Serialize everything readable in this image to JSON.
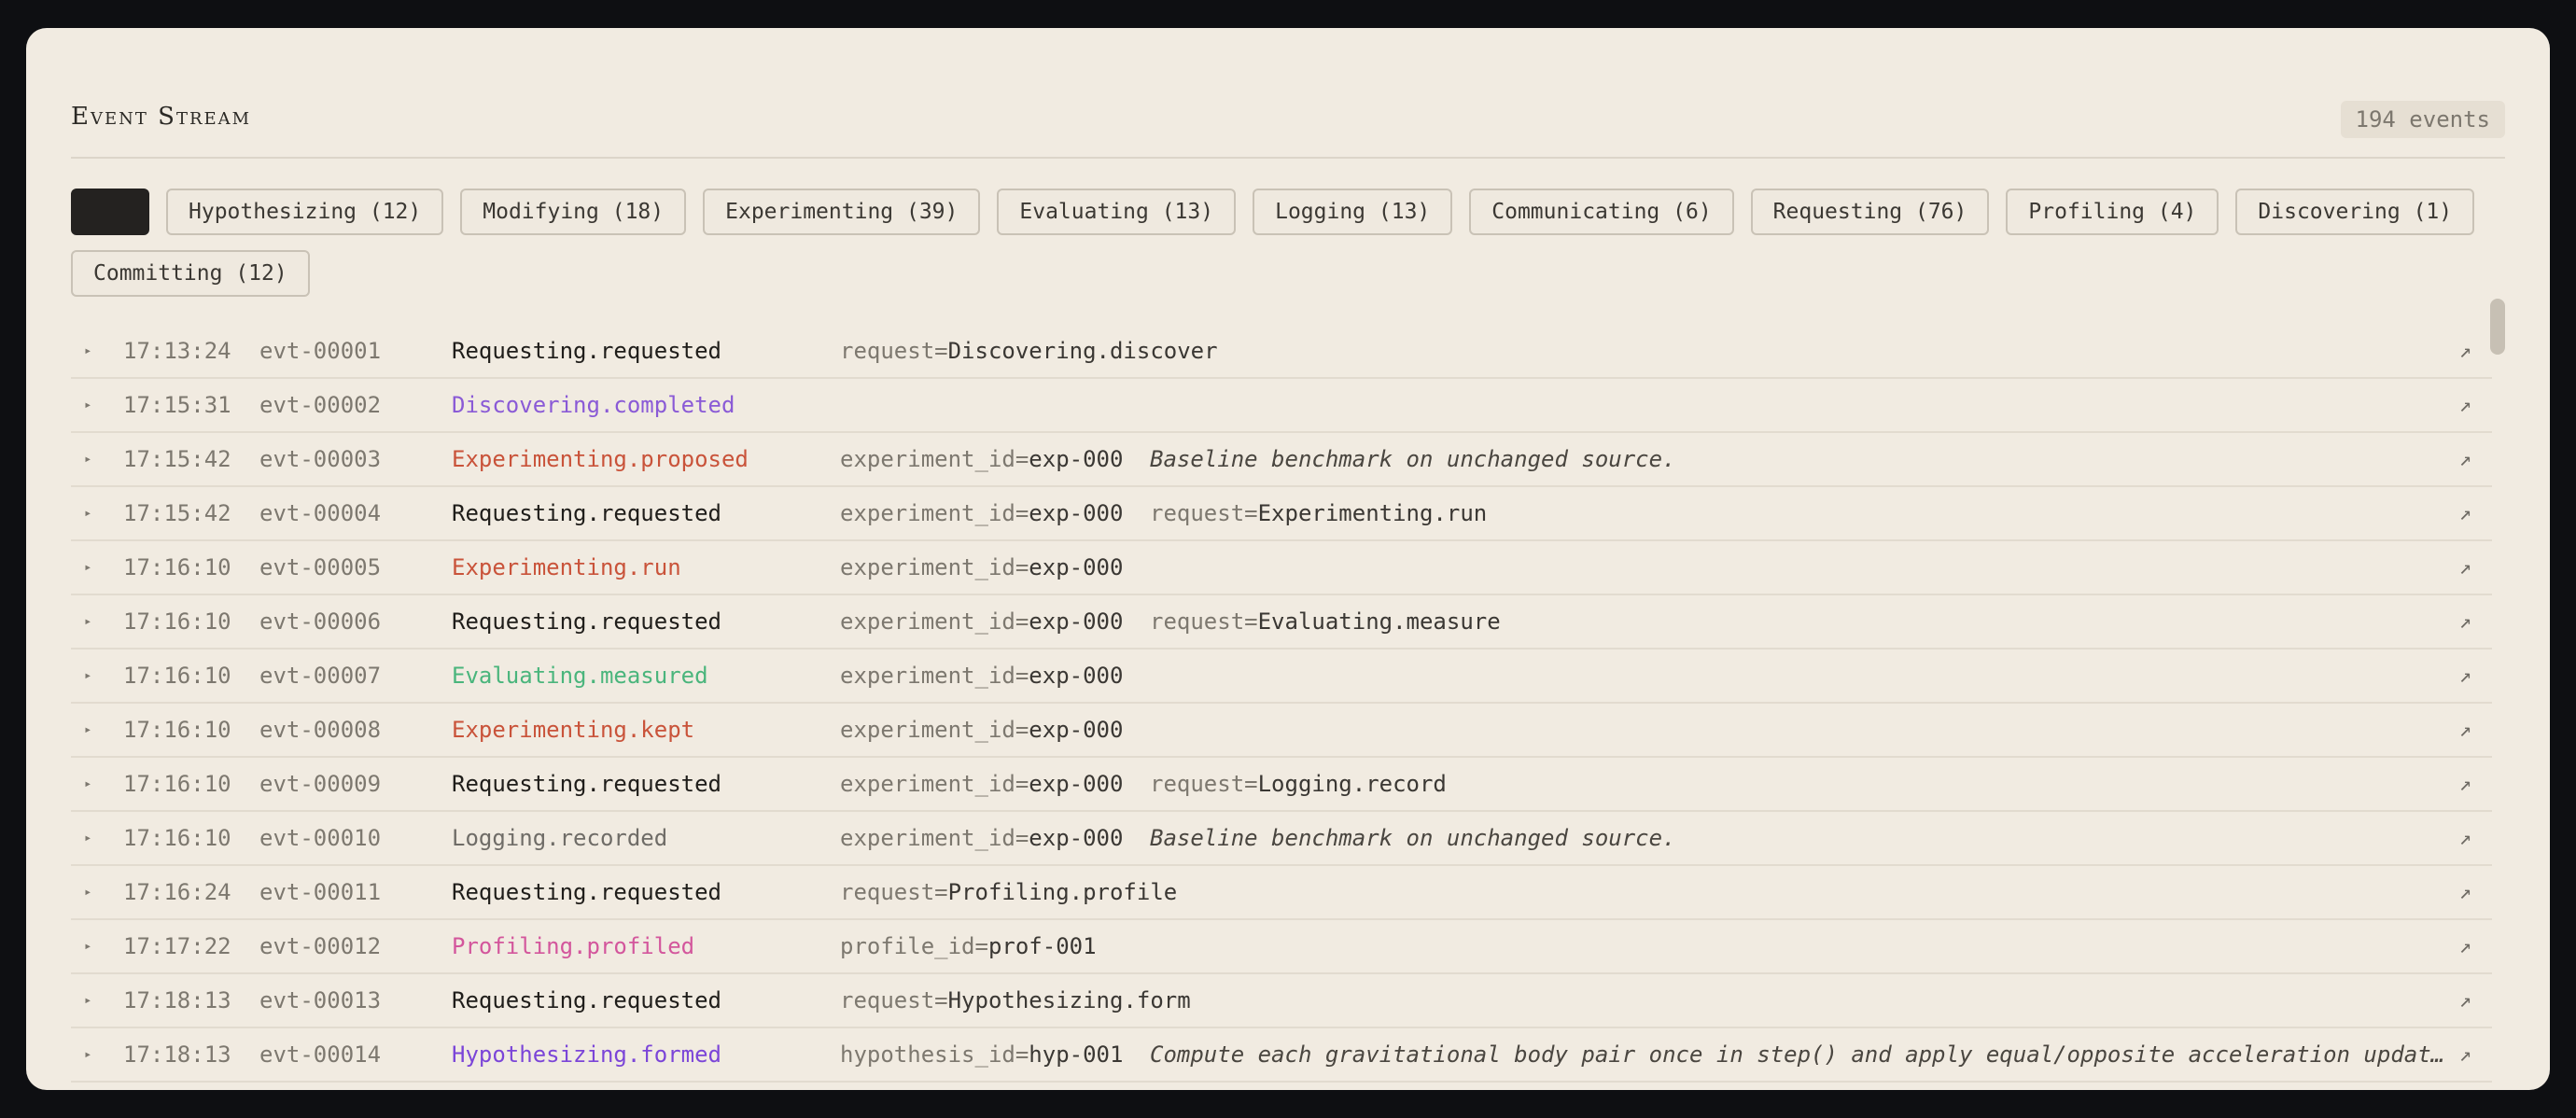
{
  "header": {
    "title": "Event Stream",
    "count": "194 events"
  },
  "filters": [
    {
      "label": "",
      "active": true
    },
    {
      "label": "Hypothesizing (12)"
    },
    {
      "label": "Modifying (18)"
    },
    {
      "label": "Experimenting (39)"
    },
    {
      "label": "Evaluating (13)"
    },
    {
      "label": "Logging (13)"
    },
    {
      "label": "Communicating (6)"
    },
    {
      "label": "Requesting (76)"
    },
    {
      "label": "Profiling (4)"
    },
    {
      "label": "Discovering (1)"
    },
    {
      "label": "Committing (12)"
    }
  ],
  "colors": {
    "requesting": "#1f1d1a",
    "discovering": "#8a5ad6",
    "experimenting": "#c9533a",
    "evaluating": "#4ab57c",
    "logging": "#6f6c67",
    "profiling": "#d3569c",
    "hypothesizing": "#7b45d8"
  },
  "events": [
    {
      "time": "17:13:24",
      "id": "evt-00001",
      "type": "Requesting.requested",
      "color": "requesting",
      "k1": "request=",
      "v1": "Discovering.discover"
    },
    {
      "time": "17:15:31",
      "id": "evt-00002",
      "type": "Discovering.completed",
      "color": "discovering"
    },
    {
      "time": "17:15:42",
      "id": "evt-00003",
      "type": "Experimenting.proposed",
      "color": "experimenting",
      "k1": "experiment_id=",
      "v1": "exp-000",
      "note": "Baseline benchmark on unchanged source."
    },
    {
      "time": "17:15:42",
      "id": "evt-00004",
      "type": "Requesting.requested",
      "color": "requesting",
      "k1": "experiment_id=",
      "v1": "exp-000",
      "k2": "request=",
      "v2": "Experimenting.run"
    },
    {
      "time": "17:16:10",
      "id": "evt-00005",
      "type": "Experimenting.run",
      "color": "experimenting",
      "k1": "experiment_id=",
      "v1": "exp-000"
    },
    {
      "time": "17:16:10",
      "id": "evt-00006",
      "type": "Requesting.requested",
      "color": "requesting",
      "k1": "experiment_id=",
      "v1": "exp-000",
      "k2": "request=",
      "v2": "Evaluating.measure"
    },
    {
      "time": "17:16:10",
      "id": "evt-00007",
      "type": "Evaluating.measured",
      "color": "evaluating",
      "k1": "experiment_id=",
      "v1": "exp-000"
    },
    {
      "time": "17:16:10",
      "id": "evt-00008",
      "type": "Experimenting.kept",
      "color": "experimenting",
      "k1": "experiment_id=",
      "v1": "exp-000"
    },
    {
      "time": "17:16:10",
      "id": "evt-00009",
      "type": "Requesting.requested",
      "color": "requesting",
      "k1": "experiment_id=",
      "v1": "exp-000",
      "k2": "request=",
      "v2": "Logging.record"
    },
    {
      "time": "17:16:10",
      "id": "evt-00010",
      "type": "Logging.recorded",
      "color": "logging",
      "k1": "experiment_id=",
      "v1": "exp-000",
      "note": "Baseline benchmark on unchanged source."
    },
    {
      "time": "17:16:24",
      "id": "evt-00011",
      "type": "Requesting.requested",
      "color": "requesting",
      "k1": "request=",
      "v1": "Profiling.profile"
    },
    {
      "time": "17:17:22",
      "id": "evt-00012",
      "type": "Profiling.profiled",
      "color": "profiling",
      "k1": "profile_id=",
      "v1": "prof-001"
    },
    {
      "time": "17:18:13",
      "id": "evt-00013",
      "type": "Requesting.requested",
      "color": "requesting",
      "k1": "request=",
      "v1": "Hypothesizing.form"
    },
    {
      "time": "17:18:13",
      "id": "evt-00014",
      "type": "Hypothesizing.formed",
      "color": "hypothesizing",
      "k1": "hypothesis_id=",
      "v1": "hyp-001",
      "note": "Compute each gravitational body pair once in step() and apply equal/opposite acceleration updat…"
    }
  ],
  "icons": {
    "expand": "triangle-right-icon",
    "open": "arrow-up-right-icon"
  }
}
